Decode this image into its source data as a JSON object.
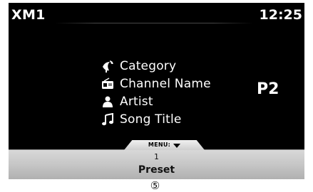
{
  "header": {
    "source": "XM1",
    "time": "12:25"
  },
  "info": {
    "items": [
      {
        "icon": "satellite-dish-icon",
        "label": "Category"
      },
      {
        "icon": "radio-icon",
        "label": "Channel Name"
      },
      {
        "icon": "person-icon",
        "label": "Artist"
      },
      {
        "icon": "music-note-icon",
        "label": "Song Title"
      }
    ]
  },
  "preset_tag": "P2",
  "menu": {
    "label": "MENU:",
    "preset_number": "1",
    "preset_label": "Preset"
  },
  "callout": "⑤"
}
